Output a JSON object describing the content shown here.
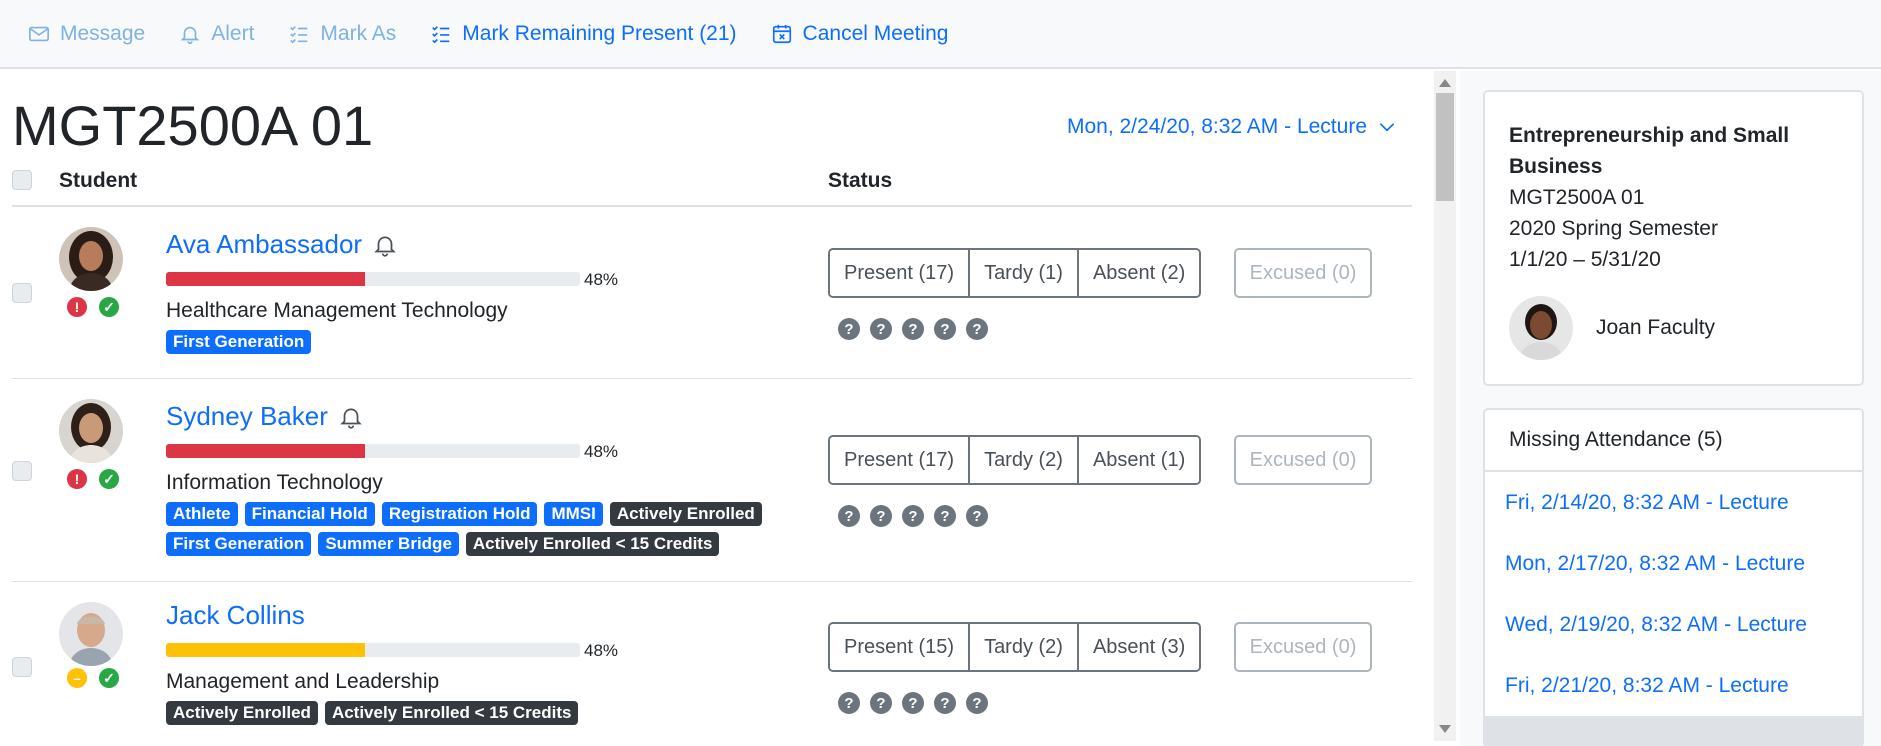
{
  "toolbar": {
    "message": "Message",
    "alert": "Alert",
    "mark_as": "Mark As",
    "mark_remaining": "Mark Remaining Present (21)",
    "cancel_meeting": "Cancel Meeting"
  },
  "course": {
    "title": "MGT2500A 01",
    "session": "Mon, 2/24/20, 8:32 AM - Lecture"
  },
  "table": {
    "col_student": "Student",
    "col_status": "Status"
  },
  "students": [
    {
      "name": "Ava Ambassador",
      "progress_pct": "48%",
      "progress_color": "#dc3545",
      "program": "Healthcare Management Technology",
      "badges_blue": [
        "First Generation"
      ],
      "present": "Present (17)",
      "tardy": "Tardy (1)",
      "absent": "Absent (2)",
      "excused": "Excused (0)",
      "status_icons": [
        "alert-red",
        "check-green"
      ]
    },
    {
      "name": "Sydney Baker",
      "progress_pct": "48%",
      "progress_color": "#dc3545",
      "program": "Information Technology",
      "badges_row1": [
        "Athlete",
        "Financial Hold",
        "Registration Hold",
        "MMSI",
        "Actively Enrolled"
      ],
      "badges_row2": [
        "First Generation",
        "Summer Bridge",
        "Actively Enrolled < 15 Credits"
      ],
      "present": "Present (17)",
      "tardy": "Tardy (2)",
      "absent": "Absent (1)",
      "excused": "Excused (0)",
      "status_icons": [
        "alert-red",
        "check-green"
      ]
    },
    {
      "name": "Jack Collins",
      "progress_pct": "48%",
      "progress_color": "#ffc107",
      "program": "Management and Leadership",
      "badges_dark": [
        "Actively Enrolled",
        "Actively Enrolled < 15 Credits"
      ],
      "present": "Present (15)",
      "tardy": "Tardy (2)",
      "absent": "Absent (3)",
      "excused": "Excused (0)",
      "status_icons": [
        "minus-yellow",
        "check-green"
      ]
    }
  ],
  "info": {
    "title": "Entrepreneurship and Small Business",
    "code": "MGT2500A 01",
    "semester": "2020 Spring Semester",
    "dates": "1/1/20 – 5/31/20",
    "faculty": "Joan Faculty"
  },
  "missing": {
    "header": "Missing Attendance (5)",
    "items": [
      "Fri, 2/14/20, 8:32 AM - Lecture",
      "Mon, 2/17/20, 8:32 AM - Lecture",
      "Wed, 2/19/20, 8:32 AM - Lecture",
      "Fri, 2/21/20, 8:32 AM - Lecture"
    ]
  },
  "glyphs": {
    "question": "?",
    "exclaim": "!",
    "check": "✓",
    "minus": "–"
  },
  "colors": {
    "link": "#0d6efd",
    "danger": "#dc3545",
    "success": "#28a745",
    "warning": "#ffc107",
    "dark_badge": "#343a40"
  }
}
